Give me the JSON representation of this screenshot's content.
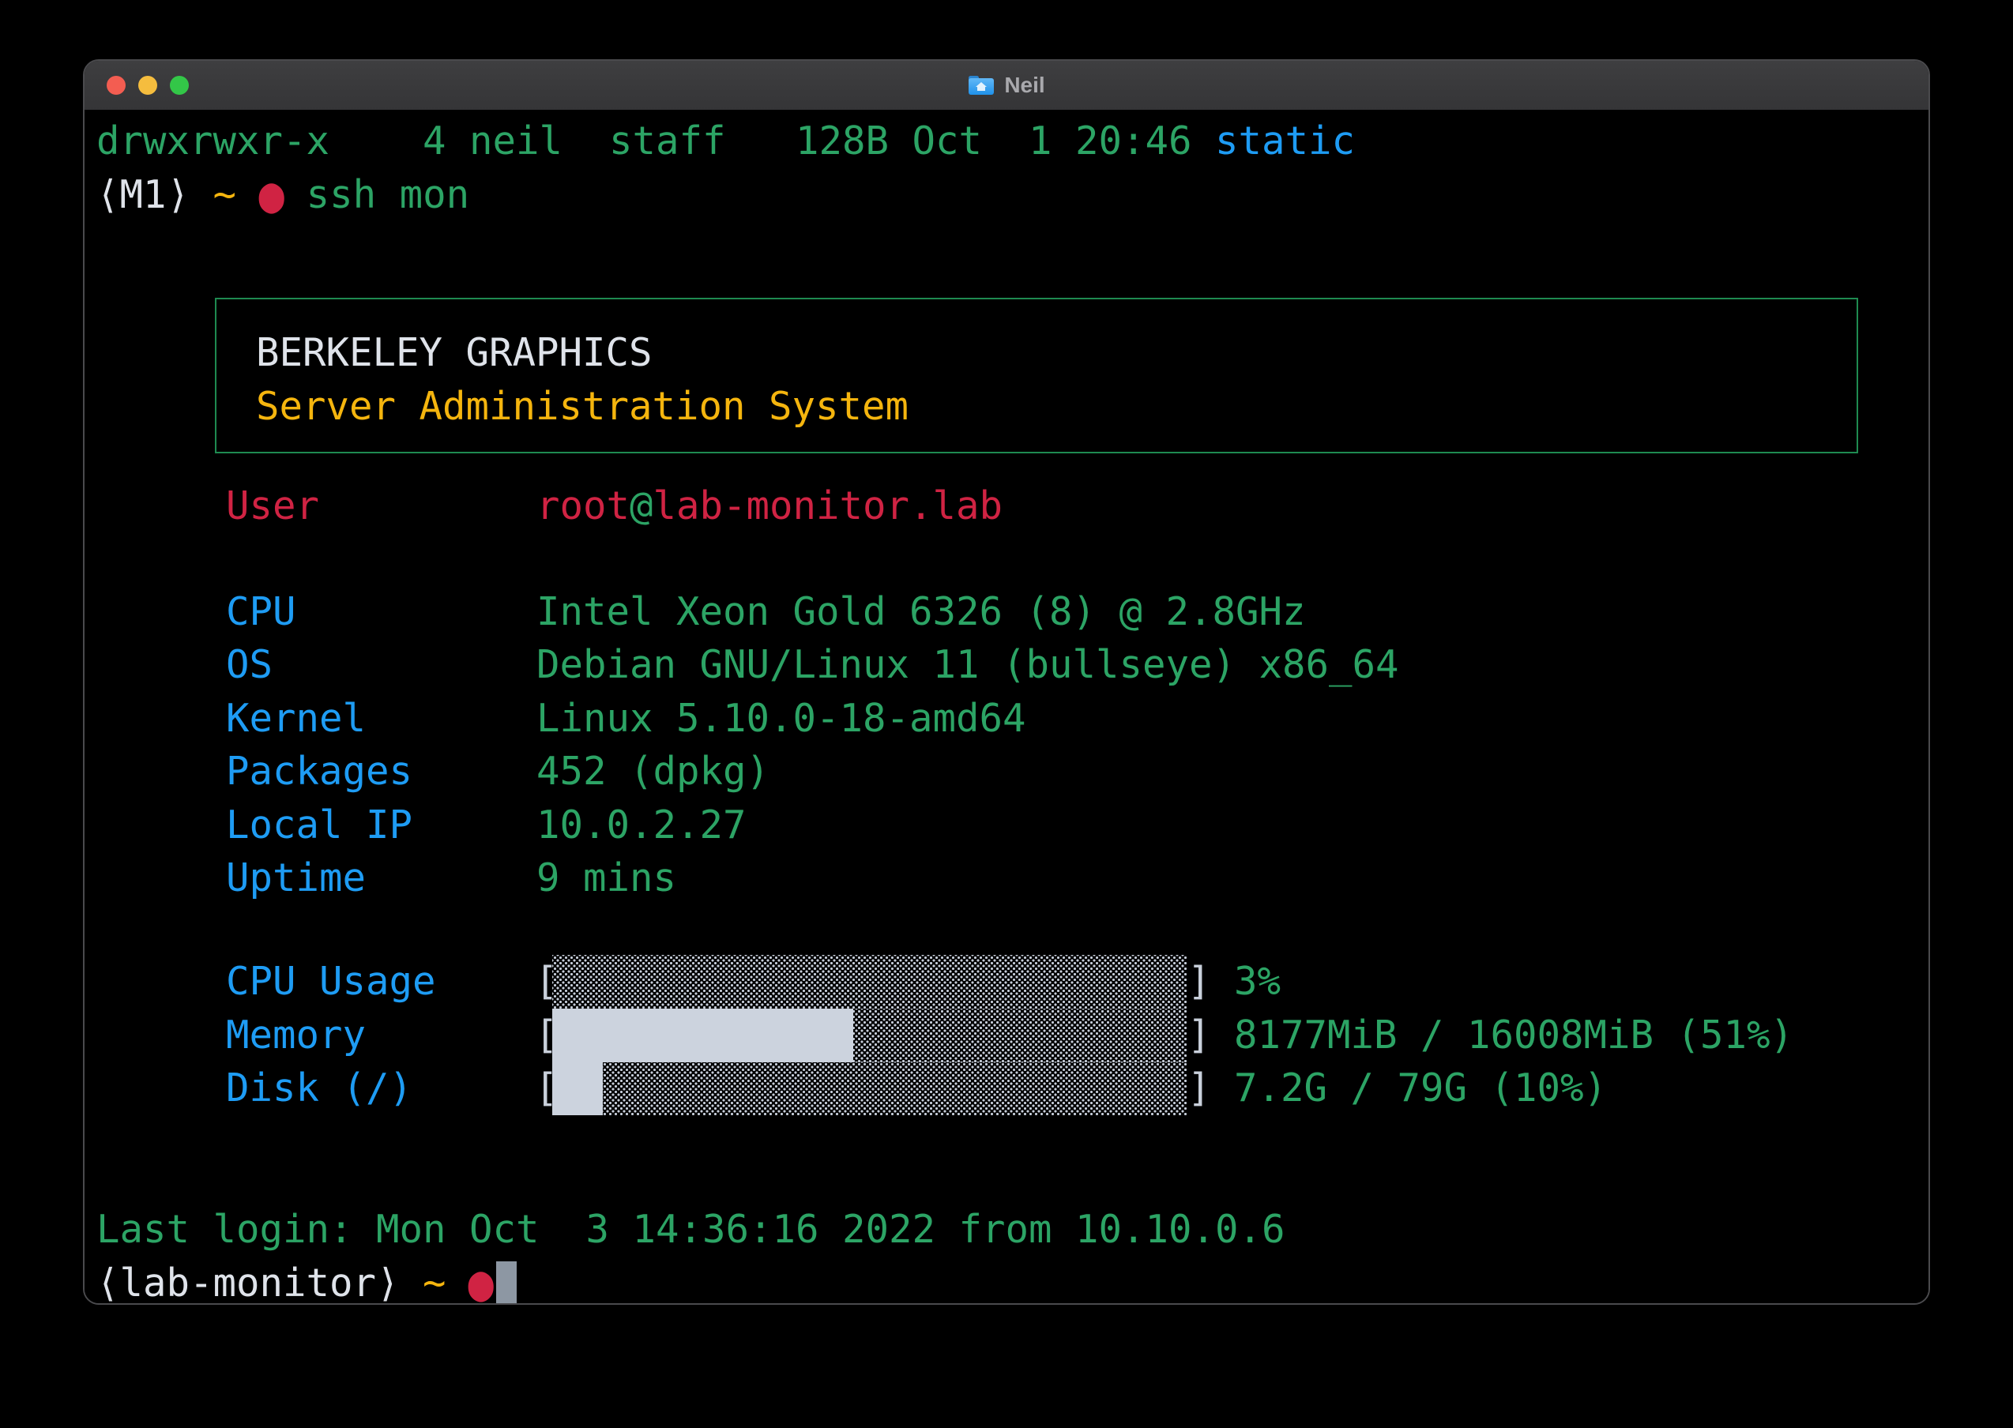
{
  "window": {
    "title": "Neil",
    "icon": "home-folder-icon",
    "traffic_lights": [
      "close",
      "minimize",
      "zoom"
    ]
  },
  "terminal": {
    "ls_line": {
      "text": "drwxrwxr-x    4 neil  staff   128B Oct  1 20:46 ",
      "highlight": "static"
    },
    "prompt1": {
      "host": "⟨M1⟩",
      "tilde": "~",
      "dot": "●",
      "command": "ssh mon"
    },
    "banner": {
      "title": "BERKELEY GRAPHICS",
      "subtitle": "Server Administration System"
    },
    "user_row": {
      "label": "User",
      "value_user": "root",
      "value_at": "@",
      "value_host": "lab-monitor.lab"
    },
    "info_rows": [
      {
        "label": "CPU",
        "value": "Intel Xeon Gold 6326 (8) @ 2.8GHz"
      },
      {
        "label": "OS",
        "value": "Debian GNU/Linux 11 (bullseye) x86_64"
      },
      {
        "label": "Kernel",
        "value": "Linux 5.10.0-18-amd64"
      },
      {
        "label": "Packages",
        "value": "452 (dpkg)"
      },
      {
        "label": "Local IP",
        "value": "10.0.2.27"
      },
      {
        "label": "Uptime",
        "value": "9 mins"
      }
    ],
    "bar_bracket_open": "[",
    "bar_bracket_close": "]",
    "bars": [
      {
        "label": "CPU Usage",
        "value": "3%",
        "fill_percent": 0
      },
      {
        "label": "Memory",
        "value": "8177MiB / 16008MiB (51%)",
        "fill_percent": 47.5
      },
      {
        "label": "Disk (/)",
        "value": "7.2G / 79G (10%)",
        "fill_percent": 8
      }
    ],
    "last_login": "Last login: Mon Oct  3 14:36:16 2022 from 10.10.0.6",
    "prompt2": {
      "host": "⟨lab-monitor⟩",
      "tilde": "~",
      "dot": "●"
    }
  },
  "colors": {
    "green": "#2ca465",
    "blue": "#1e9cf4",
    "red": "#d02343",
    "gold": "#f5b50e",
    "white": "#dfe3ea",
    "bar_fill": "#ccd3de",
    "bar_dither_dot": "#c6cdd9",
    "cursor": "#8d97a3",
    "banner_border": "#1e8a50",
    "titlebar": "#39393b"
  }
}
